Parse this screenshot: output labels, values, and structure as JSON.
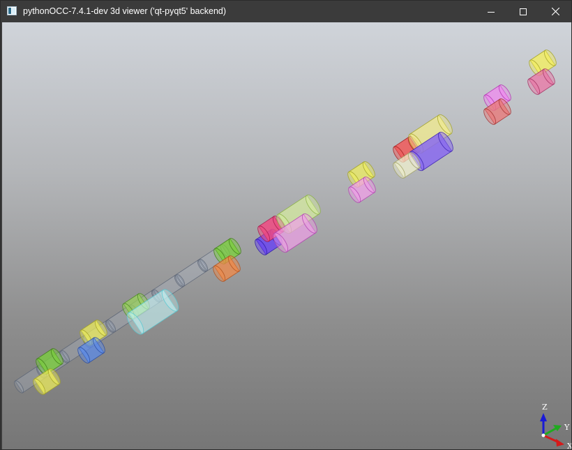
{
  "window": {
    "title": "pythonOCC-7.4.1-dev 3d viewer ('qt-pyqt5' backend)",
    "controls": {
      "minimize_icon": "minimize-icon",
      "maximize_icon": "maximize-icon",
      "close_icon": "close-icon"
    }
  },
  "viewport": {
    "background_top": "#d0d4da",
    "background_bottom": "#767676"
  },
  "trihedron": {
    "z_label": "Z",
    "y_label": "Y",
    "x_label": "X",
    "z_color": "#1a1ad6",
    "y_color": "#1faa1f",
    "x_color": "#d41a1a"
  }
}
